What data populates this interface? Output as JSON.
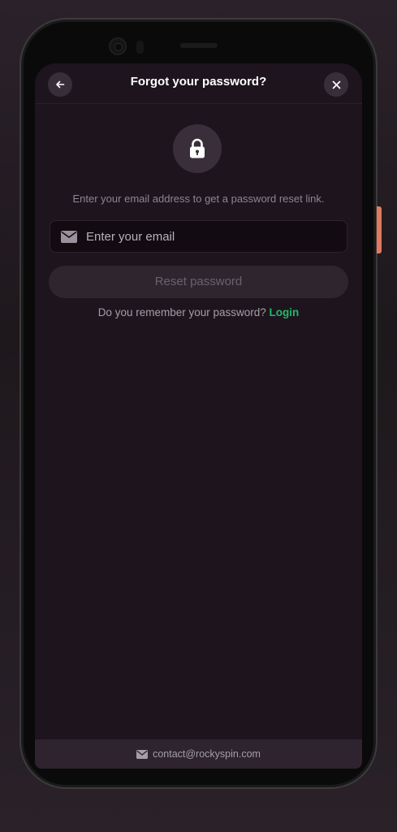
{
  "header": {
    "title": "Forgot your password?",
    "back_icon": "arrow-left-icon",
    "close_icon": "close-icon"
  },
  "lock_icon": "lock-icon",
  "form": {
    "instruction": "Enter your email address to get a password reset link.",
    "email": {
      "value": "",
      "placeholder": "Enter your email",
      "icon": "mail-icon"
    },
    "reset_label": "Reset password",
    "remember_text": "Do you remember your password?",
    "login_label": "Login"
  },
  "footer": {
    "contact_email": "contact@rockyspin.com",
    "icon": "mail-icon"
  },
  "colors": {
    "background": "#1e141e",
    "accent_green": "#22b86a",
    "button_disabled": "#2f252f",
    "side_button": "#e07a5f"
  }
}
